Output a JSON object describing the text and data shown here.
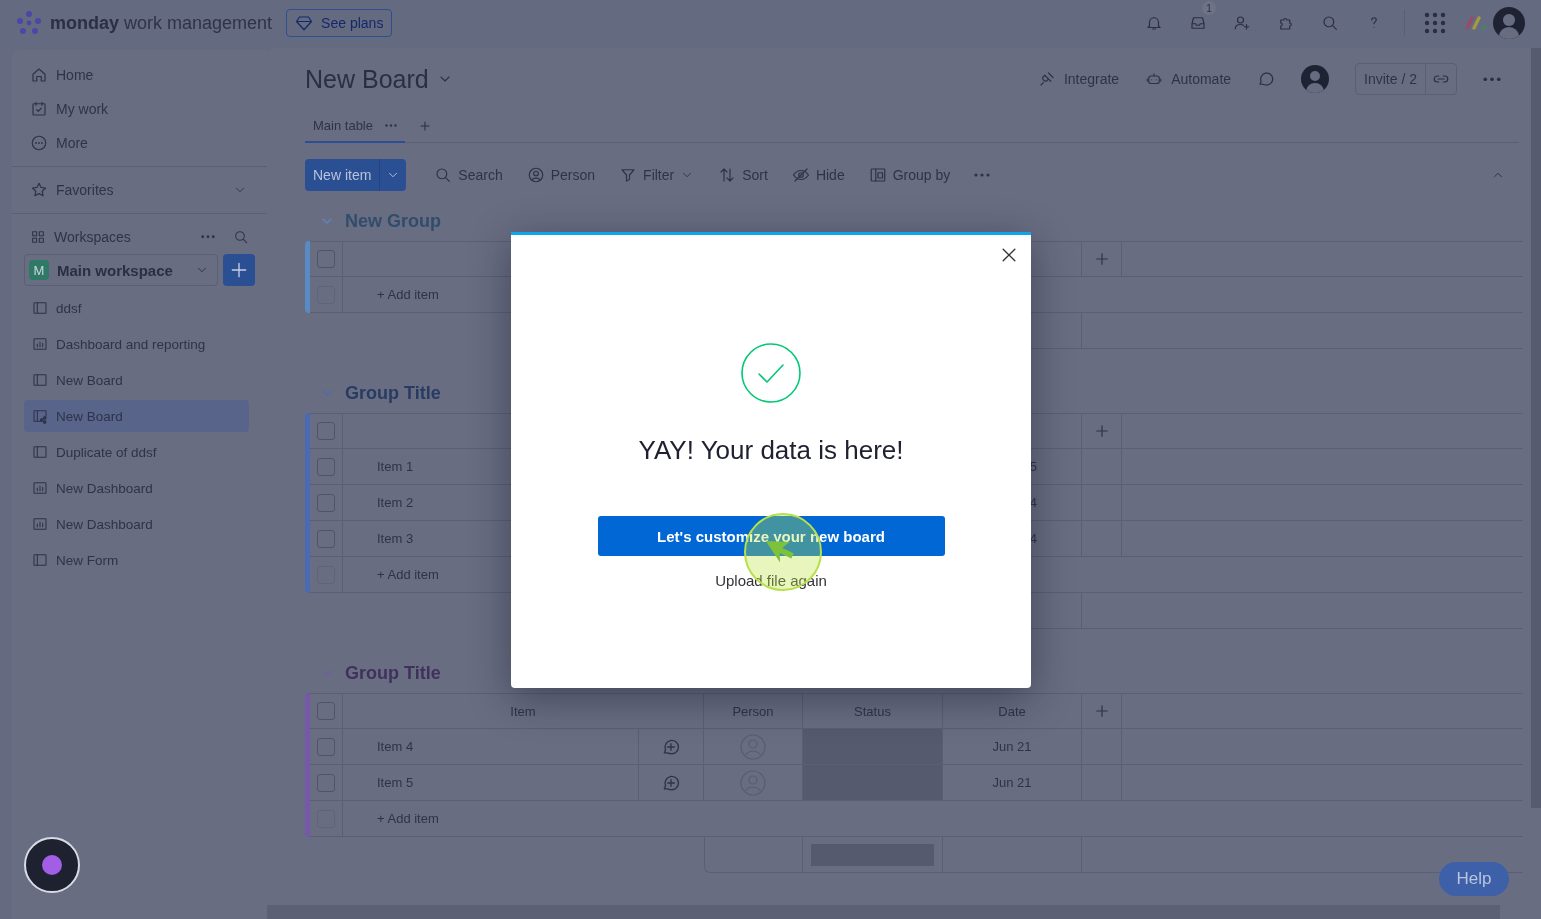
{
  "topbar": {
    "brand_bold": "monday",
    "brand_rest": "work management",
    "plans_button": "See plans",
    "inbox_badge": "1"
  },
  "sidebar": {
    "nav": [
      {
        "label": "Home"
      },
      {
        "label": "My work"
      },
      {
        "label": "More"
      }
    ],
    "favorites": "Favorites",
    "workspaces": "Workspaces",
    "workspace": {
      "initial": "M",
      "name": "Main workspace"
    },
    "boards": [
      {
        "label": "ddsf",
        "kind": "board",
        "selected": false
      },
      {
        "label": "Dashboard and reporting",
        "kind": "dashboard",
        "selected": false
      },
      {
        "label": "New Board",
        "kind": "board",
        "selected": false
      },
      {
        "label": "New Board",
        "kind": "shared",
        "selected": true
      },
      {
        "label": "Duplicate of ddsf",
        "kind": "board",
        "selected": false
      },
      {
        "label": "New Dashboard",
        "kind": "dashboard",
        "selected": false
      },
      {
        "label": "New Dashboard",
        "kind": "dashboard",
        "selected": false
      },
      {
        "label": "New Form",
        "kind": "board",
        "selected": false
      }
    ]
  },
  "board": {
    "title": "New Board",
    "actions": [
      {
        "label": "Integrate"
      },
      {
        "label": "Automate"
      }
    ],
    "invite": "Invite / 2",
    "views": [
      {
        "label": "Main table",
        "selected": true
      }
    ],
    "new_item": "New item",
    "tools": [
      {
        "label": "Search",
        "dropdown": false
      },
      {
        "label": "Person",
        "dropdown": false
      },
      {
        "label": "Filter",
        "dropdown": true
      },
      {
        "label": "Sort",
        "dropdown": false
      },
      {
        "label": "Hide",
        "dropdown": false
      },
      {
        "label": "Group by",
        "dropdown": false
      }
    ]
  },
  "groups": [
    {
      "title": "New Group",
      "color": "#5a8ac4",
      "all_checked": false,
      "add_item": "+ Add item",
      "add_checkbox_disabled": true
    },
    {
      "title": "Group Title",
      "color": "#4a6bb3",
      "all_checked": false,
      "rows": [
        {
          "name": "Item 1",
          "date": "5",
          "checked": false
        },
        {
          "name": "Item 2",
          "date": "4",
          "checked": false
        },
        {
          "name": "Item 3",
          "date": "4",
          "checked": false
        }
      ],
      "add_item": "+ Add item",
      "add_checkbox_disabled": true
    },
    {
      "title": "Group Title",
      "color": "#7558a8",
      "all_checked": false,
      "columns": [
        "Item",
        "Person",
        "Status",
        "Date"
      ],
      "rows": [
        {
          "name": "Item 4",
          "date": "Jun 21",
          "checked": false
        },
        {
          "name": "Item 5",
          "date": "Jun 21",
          "checked": false
        }
      ],
      "add_item": "+ Add item",
      "add_checkbox_disabled": true
    }
  ],
  "modal": {
    "title": "YAY! Your data is here!",
    "primary_button": "Let's customize your new board",
    "link": "Upload file again"
  },
  "help_button": "Help"
}
